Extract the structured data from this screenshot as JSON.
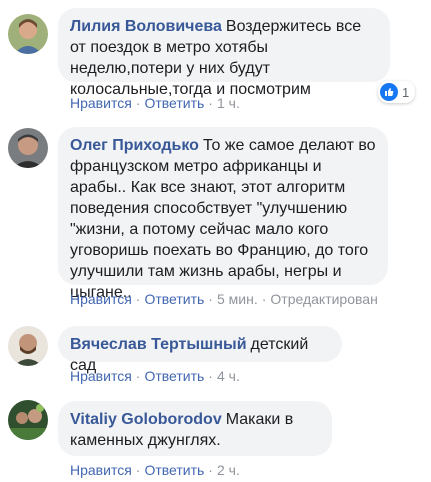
{
  "comments": [
    {
      "author": "Лилия Воловичева",
      "text": "Воздержитесь все от поездок в метро хотябы неделю,потери у них будут колосальные,тогда и посмотрим",
      "like_label": "Нравится",
      "reply_label": "Ответить",
      "time": "1 ч.",
      "reaction_count": "1"
    },
    {
      "author": "Олег Приходько",
      "text": "То же самое делают во французском метро африканцы и арабы.. Как все знают, этот алгоритм поведения способствует \"улучшению \"жизни, а потому сейчас мало кого уговоришь поехать во Францию, до того улучшили там жизнь арабы, негры и цыгане..",
      "like_label": "Нравится",
      "reply_label": "Ответить",
      "time": "5 мин.",
      "edited_label": "Отредактирован"
    },
    {
      "author": "Вячеслав Тертышный",
      "text": "детский сад",
      "like_label": "Нравится",
      "reply_label": "Ответить",
      "time": "4 ч."
    },
    {
      "author": "Vitaliy Goloborodov",
      "text": "Макаки в каменных джунглях.",
      "like_label": "Нравится",
      "reply_label": "Ответить",
      "time": "2 ч."
    }
  ]
}
